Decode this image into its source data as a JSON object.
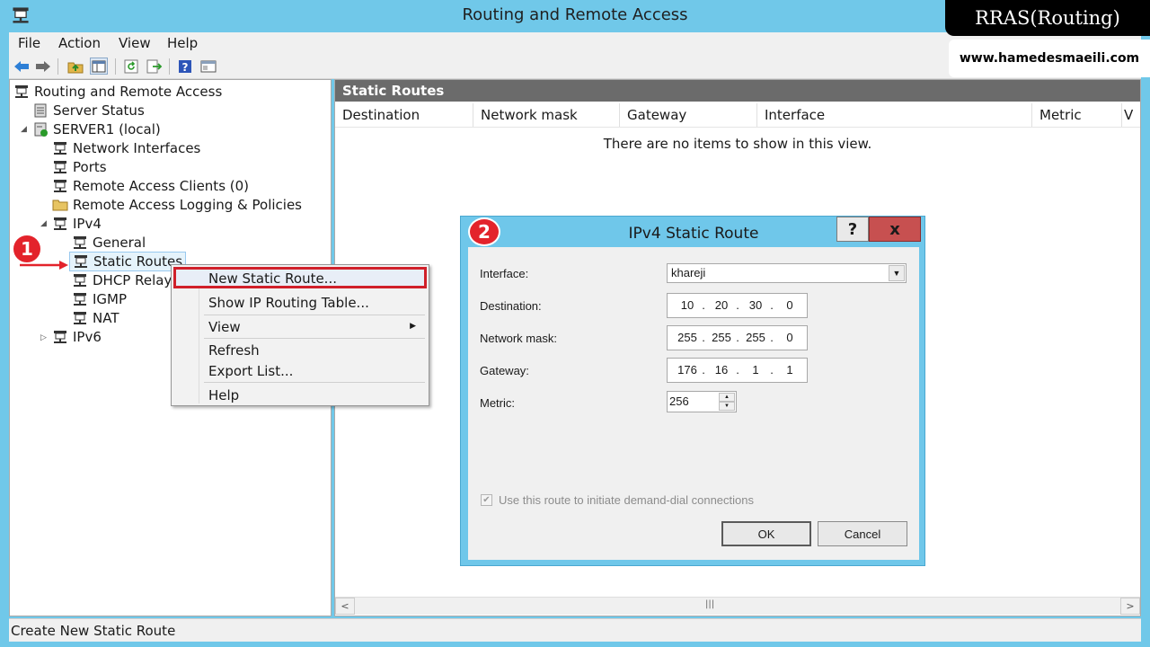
{
  "window": {
    "title": "Routing and Remote Access"
  },
  "menu": {
    "items": [
      "File",
      "Action",
      "View",
      "Help"
    ]
  },
  "tree": {
    "root": "Routing and Remote Access",
    "server_status": "Server Status",
    "server": "SERVER1 (local)",
    "network_interfaces": "Network Interfaces",
    "ports": "Ports",
    "remote_access_clients": "Remote Access Clients (0)",
    "logging": "Remote Access Logging & Policies",
    "ipv4": "IPv4",
    "general": "General",
    "static_routes": "Static Routes",
    "dhcp_relay": "DHCP Relay",
    "igmp": "IGMP",
    "nat": "NAT",
    "ipv6": "IPv6"
  },
  "right_pane": {
    "header": "Static Routes",
    "columns": [
      "Destination",
      "Network mask",
      "Gateway",
      "Interface",
      "Metric",
      "V"
    ],
    "empty_message": "There are no items to show in this view."
  },
  "context_menu": {
    "items": [
      "New Static Route...",
      "Show IP Routing Table...",
      "View",
      "Refresh",
      "Export List...",
      "Help"
    ]
  },
  "dialog": {
    "title": "IPv4 Static Route",
    "help_label": "?",
    "close_label": "x",
    "interface_label": "Interface:",
    "interface_value": "khareji",
    "destination_label": "Destination:",
    "destination": [
      "10",
      "20",
      "30",
      "0"
    ],
    "mask_label": "Network mask:",
    "mask": [
      "255",
      "255",
      "255",
      "0"
    ],
    "gateway_label": "Gateway:",
    "gateway": [
      "176",
      "16",
      "1",
      "1"
    ],
    "metric_label": "Metric:",
    "metric_value": "256",
    "demand_dial_label": "Use this route to initiate demand-dial connections",
    "demand_dial_checked": true,
    "ok_label": "OK",
    "cancel_label": "Cancel"
  },
  "annotations": {
    "step1": "1",
    "step2": "2"
  },
  "status": {
    "text": "Create New Static Route"
  },
  "watermark": {
    "title": "RRAS(Routing)",
    "site": "www.hamedesmaeili.com"
  },
  "colors": {
    "window_frame": "#70c8e9",
    "highlight_border": "#d0202a",
    "close_button": "#c75050",
    "pane_header": "#6b6b6b"
  },
  "icons": [
    "app-icon",
    "back-icon",
    "forward-icon",
    "up-folder-icon",
    "show-tree-icon",
    "refresh-icon",
    "export-icon",
    "help-icon",
    "properties-icon",
    "network-node-icon",
    "server-icon",
    "folder-icon"
  ]
}
